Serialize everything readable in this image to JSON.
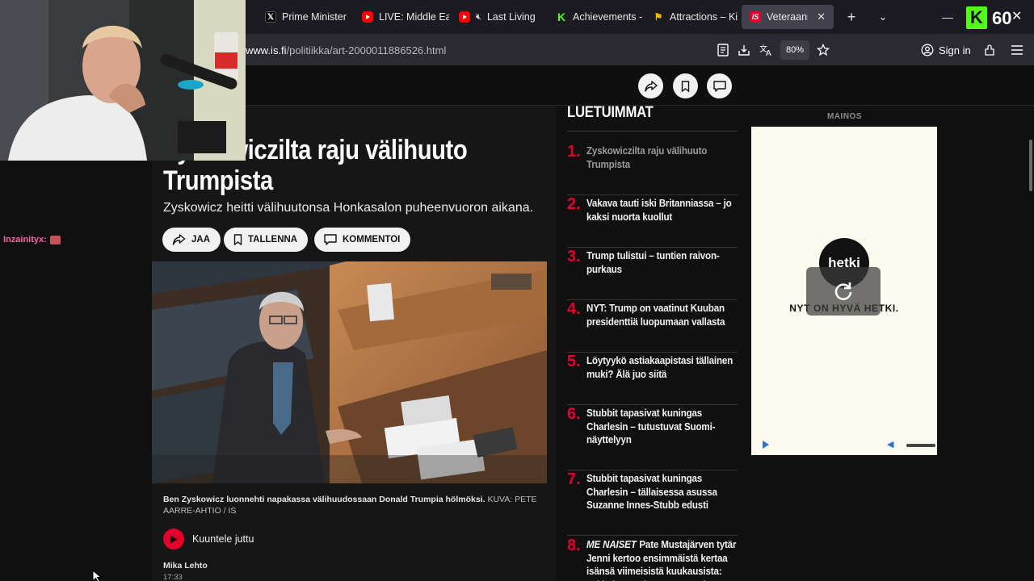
{
  "browser": {
    "tabs": [
      {
        "label": "Prime Minister",
        "icon": "x-logo-icon",
        "active": false
      },
      {
        "label": "LIVE: Middle Ea",
        "icon": "youtube-icon",
        "active": false
      },
      {
        "label": "Last Living",
        "icon": "youtube-icon",
        "active": false
      },
      {
        "label": "Achievements -",
        "icon": "kick-icon",
        "active": false
      },
      {
        "label": "Attractions – Ki",
        "icon": "flag-icon",
        "active": false
      },
      {
        "label": "Veteraanikan",
        "icon": "is-icon",
        "active": true
      }
    ],
    "url_domain": "www.is.fi",
    "url_path": "/politiikka/art-2000011886526.html",
    "zoom": "80%",
    "sign_in_label": "Sign in"
  },
  "stream": {
    "viewer_count": "60",
    "chat": {
      "user": "Inzainityx:"
    }
  },
  "article": {
    "headline_line1": "Zyskowiczilta raju välihuuto",
    "headline_line2": "Trumpista",
    "subheadline": "Zyskowicz heitti välihuutonsa Honkasalon puheenvuoron aikana.",
    "actions": {
      "share": "JAA",
      "save": "TALLENNA",
      "comment": "KOMMENTOI"
    },
    "caption": "Ben Zyskowicz luonnehti napakassa välihuudossaan Donald Trumpia hölmöksi.",
    "credit": "KUVA: PETE AARRE-AHTIO / IS",
    "listen_label": "Kuuntele juttu",
    "author": "Mika Lehto",
    "time": "17:33"
  },
  "most_read": {
    "title": "LUETUIMMAT",
    "items": [
      {
        "num": "1.",
        "tag": "",
        "text": "Zyskowiczilta raju välihuuto Trumpista"
      },
      {
        "num": "2.",
        "tag": "",
        "text": "Vakava tauti iski Britanniassa – jo kaksi nuorta kuollut"
      },
      {
        "num": "3.",
        "tag": "",
        "text": "Trump tulistui – tuntien raivon-purkaus"
      },
      {
        "num": "4.",
        "tag": "",
        "text": "NYT: Trump on vaatinut Kuuban presidenttiä luopumaan vallasta"
      },
      {
        "num": "5.",
        "tag": "",
        "text": "Löytyykö astiakaapistasi tällainen muki? Älä juo siitä"
      },
      {
        "num": "6.",
        "tag": "",
        "text": "Stubbit tapasivat kuningas Charlesin – tutustuvat Suomi-näyttelyyn"
      },
      {
        "num": "7.",
        "tag": "",
        "text": "Stubbit tapasivat kuningas Charlesin – tällaisessa asussa Suzanne Innes-Stubb edusti"
      },
      {
        "num": "8.",
        "tag": "ME NAISET",
        "text": "Pate Mustajärven tytär Jenni kertoo ensimmäistä kertaa isänsä viimeisistä kuukausista: \"Ei kukaan tajunnut, että mitä"
      }
    ]
  },
  "ad": {
    "label": "MAINOS",
    "logo_text": "hetki",
    "tagline": "NYT ON HYVÄ HETKI."
  },
  "colors": {
    "accent_red": "#e4002b",
    "kick_green": "#53fc18",
    "chat_user": "#ff5fa2"
  }
}
